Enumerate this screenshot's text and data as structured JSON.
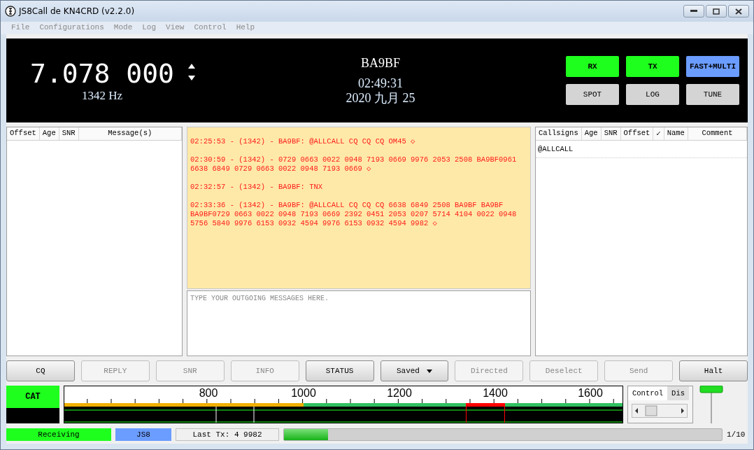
{
  "window": {
    "title": "JS8Call de KN4CRD (v2.2.0)"
  },
  "menu": [
    "File",
    "Configurations",
    "Mode",
    "Log",
    "View",
    "Control",
    "Help"
  ],
  "display": {
    "frequency": "7.078 000",
    "offset": "1342 Hz",
    "callsign": "BA9BF",
    "time": "02:49:31",
    "date": "2020 九月 25"
  },
  "mode_buttons": [
    {
      "label": "RX",
      "color": "#1eff1e"
    },
    {
      "label": "TX",
      "color": "#1eff1e"
    },
    {
      "label": "FAST+MULTI",
      "color": "#6b9cff"
    },
    {
      "label": "SPOT",
      "color": "#d4d4d4"
    },
    {
      "label": "LOG",
      "color": "#d4d4d4"
    },
    {
      "label": "TUNE",
      "color": "#d4d4d4"
    }
  ],
  "activity_table": {
    "columns": [
      "Offset",
      "Age",
      "SNR",
      "Message(s)"
    ]
  },
  "messages": [
    "02:25:53 - (1342) - BA9BF: @ALLCALL CQ CQ CQ OM45  ◇",
    "02:30:59 - (1342) - 0729 0663 0022 0948 7193 0669 9976 2053 2508 BA9BF0961 6638 6849 0729 0663 0022 0948 7193 0669  ◇",
    "02:32:57 - (1342) - BA9BF: TNX",
    "02:33:36 - (1342) - BA9BF: @ALLCALL CQ CQ CQ     6638 6849 2508 BA9BF BA9BF BA9BF0729 0663 0022 0948 7193 0669 2392 0451 2053 0207 5714 4104 0022 0948 5756 5840 9976 6153 0932 4594 9976 6153 0932 4594 9982  ◇"
  ],
  "compose": {
    "placeholder": "TYPE YOUR OUTGOING MESSAGES HERE."
  },
  "callsign_table": {
    "columns": [
      "Callsigns",
      "Age",
      "SNR",
      "Offset",
      "✓",
      "Name",
      "Comment"
    ],
    "rows": [
      "@ALLCALL"
    ]
  },
  "buttons": [
    {
      "label": "CQ",
      "disabled": false,
      "kind": "plain"
    },
    {
      "label": "REPLY",
      "disabled": true,
      "kind": "plain"
    },
    {
      "label": "SNR",
      "disabled": true,
      "kind": "plain"
    },
    {
      "label": "INFO",
      "disabled": true,
      "kind": "plain"
    },
    {
      "label": "STATUS",
      "disabled": false,
      "kind": "plain"
    },
    {
      "label": "Saved",
      "disabled": false,
      "kind": "dropdown"
    },
    {
      "label": "Directed",
      "disabled": true,
      "kind": "plain"
    },
    {
      "label": "Deselect",
      "disabled": true,
      "kind": "plain"
    },
    {
      "label": "Send",
      "disabled": true,
      "kind": "plain"
    },
    {
      "label": "Halt",
      "disabled": false,
      "kind": "plain"
    }
  ],
  "cat": {
    "label": "CAT",
    "on": true
  },
  "waterfall": {
    "scale_labels": [
      "800",
      "1000",
      "1200",
      "1400",
      "1600"
    ]
  },
  "control_tabs": [
    {
      "label": "Control",
      "selected": true
    },
    {
      "label": "Dis",
      "selected": false
    }
  ],
  "gain_slider": {
    "level": 1
  },
  "status_bar": {
    "state": "Receiving",
    "mode": "JS8",
    "last_tx": "Last Tx: 4 9982",
    "progress": {
      "level": 0.1
    },
    "progress_text": "1/10"
  }
}
